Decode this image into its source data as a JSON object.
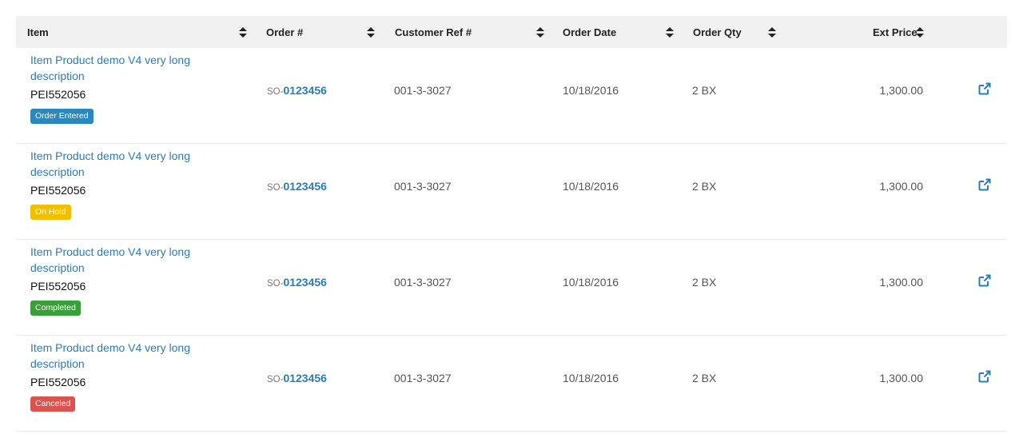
{
  "table": {
    "columns": [
      {
        "key": "item",
        "label": "Item"
      },
      {
        "key": "order",
        "label": "Order #"
      },
      {
        "key": "customer_ref",
        "label": "Customer Ref #"
      },
      {
        "key": "order_date",
        "label": "Order Date"
      },
      {
        "key": "order_qty",
        "label": "Order Qty"
      },
      {
        "key": "ext_price",
        "label": "Ext Price"
      }
    ],
    "rows": [
      {
        "item_desc": "Item Product demo V4 very long description",
        "item_code": "PEI552056",
        "status": "Order Entered",
        "status_color": "#2b88ba",
        "order_prefix": "SO-",
        "order_no": "0123456",
        "customer_ref": "001-3-3027",
        "order_date": "10/18/2016",
        "order_qty": "2 BX",
        "ext_price": "1,300.00"
      },
      {
        "item_desc": "Item Product demo V4 very long description",
        "item_code": "PEI552056",
        "status": "On Hold",
        "status_color": "#f0c000",
        "order_prefix": "SO-",
        "order_no": "0123456",
        "customer_ref": "001-3-3027",
        "order_date": "10/18/2016",
        "order_qty": "2 BX",
        "ext_price": "1,300.00"
      },
      {
        "item_desc": "Item Product demo V4 very long description",
        "item_code": "PEI552056",
        "status": "Completed",
        "status_color": "#3a9f3a",
        "order_prefix": "SO-",
        "order_no": "0123456",
        "customer_ref": "001-3-3027",
        "order_date": "10/18/2016",
        "order_qty": "2 BX",
        "ext_price": "1,300.00"
      },
      {
        "item_desc": "Item Product demo V4 very long description",
        "item_code": "PEI552056",
        "status": "Canceled",
        "status_color": "#d9534f",
        "order_prefix": "SO-",
        "order_no": "0123456",
        "customer_ref": "001-3-3027",
        "order_date": "10/18/2016",
        "order_qty": "2 BX",
        "ext_price": "1,300.00"
      }
    ],
    "icons": {
      "sort": "sort-icon",
      "open": "external-link-icon"
    },
    "colors": {
      "link": "#2b7bb9",
      "header_bg": "#f1f1f1"
    }
  }
}
